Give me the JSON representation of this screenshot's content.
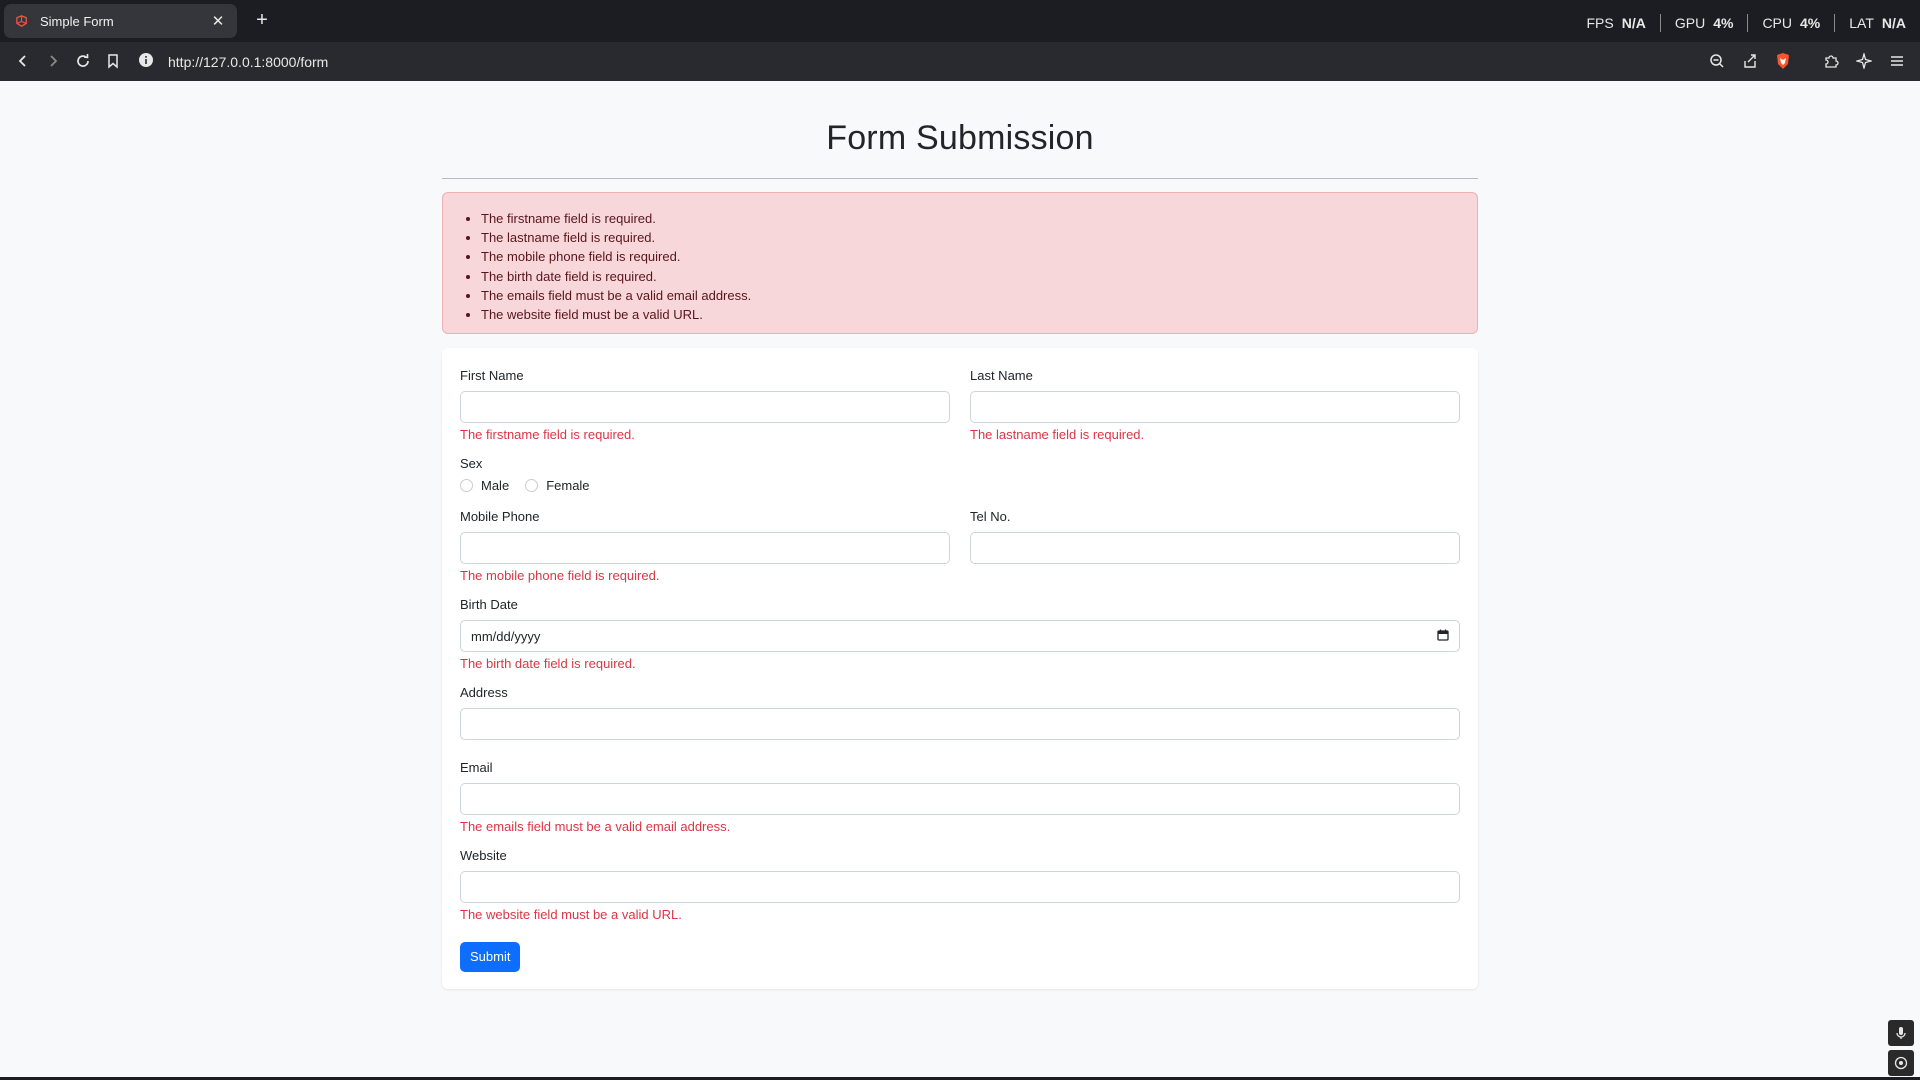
{
  "browser": {
    "tab_title": "Simple Form",
    "url": "http://127.0.0.1:8000/form",
    "stats": [
      {
        "label": "FPS",
        "value": "N/A"
      },
      {
        "label": "GPU",
        "value": "4%"
      },
      {
        "label": "CPU",
        "value": "4%"
      },
      {
        "label": "LAT",
        "value": "N/A"
      }
    ]
  },
  "page": {
    "title": "Form Submission",
    "errors": [
      "The firstname field is required.",
      "The lastname field is required.",
      "The mobile phone field is required.",
      "The birth date field is required.",
      "The emails field must be a valid email address.",
      "The website field must be a valid URL."
    ],
    "form": {
      "first_name": {
        "label": "First Name",
        "value": "",
        "error": "The firstname field is required."
      },
      "last_name": {
        "label": "Last Name",
        "value": "",
        "error": "The lastname field is required."
      },
      "sex": {
        "label": "Sex",
        "options": [
          "Male",
          "Female"
        ]
      },
      "mobile_phone": {
        "label": "Mobile Phone",
        "value": "",
        "error": "The mobile phone field is required."
      },
      "tel_no": {
        "label": "Tel No.",
        "value": ""
      },
      "birth_date": {
        "label": "Birth Date",
        "placeholder": "mm/dd/yyyy",
        "error": "The birth date field is required."
      },
      "address": {
        "label": "Address",
        "value": ""
      },
      "email": {
        "label": "Email",
        "value": "",
        "error": "The emails field must be a valid email address."
      },
      "website": {
        "label": "Website",
        "value": "",
        "error": "The website field must be a valid URL."
      },
      "submit_label": "Submit"
    }
  },
  "colors": {
    "primary": "#0d6efd",
    "danger": "#dc3545",
    "alert_bg": "#f8d7da",
    "alert_text": "#58151c"
  }
}
